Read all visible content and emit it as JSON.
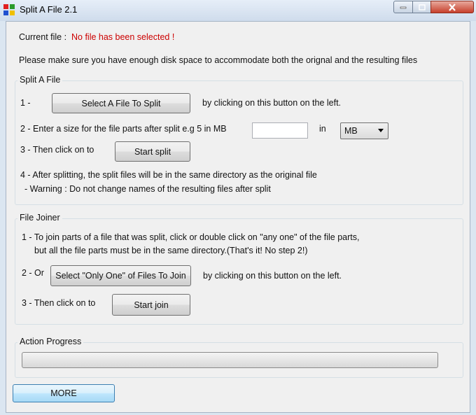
{
  "window": {
    "title": "Split A File 2.1",
    "icon": "app-icon"
  },
  "current_file": {
    "label": "Current file :",
    "value": "No file has been selected !",
    "value_color": "#cc0000"
  },
  "notice": "Please make sure you have enough disk space to accommodate both the orignal and the resulting files",
  "split_group": {
    "legend": "Split A File",
    "step1_prefix": "1 -",
    "select_button": "Select A File To Split",
    "step1_suffix": "by clicking on this button on the left.",
    "step2_text": "2 - Enter a size for the file parts after split e.g 5 in MB",
    "size_value": "",
    "in_label": "in",
    "unit_selected": "MB",
    "step3_text": "3 - Then click on to",
    "start_button": "Start split",
    "step4_text": "4 - After splitting, the split files will be in the same directory as the original file",
    "warning_text": "- Warning : Do not change names of the resulting files after split"
  },
  "join_group": {
    "legend": "File Joiner",
    "step1_line1": "1 - To join parts of a file that was split, click or double click on \"any one\" of the file parts,",
    "step1_line2": "but all the file parts must be in the same directory.(That's it! No step 2!)",
    "step2_prefix": "2 - Or",
    "select_button": "Select \"Only One\" of Files To Join",
    "step2_suffix": "by clicking on this button on the left.",
    "step3_text": "3 - Then click on to",
    "start_button": "Start join"
  },
  "progress_group": {
    "legend": "Action Progress",
    "progress_fraction": 0
  },
  "more_button": "MORE"
}
